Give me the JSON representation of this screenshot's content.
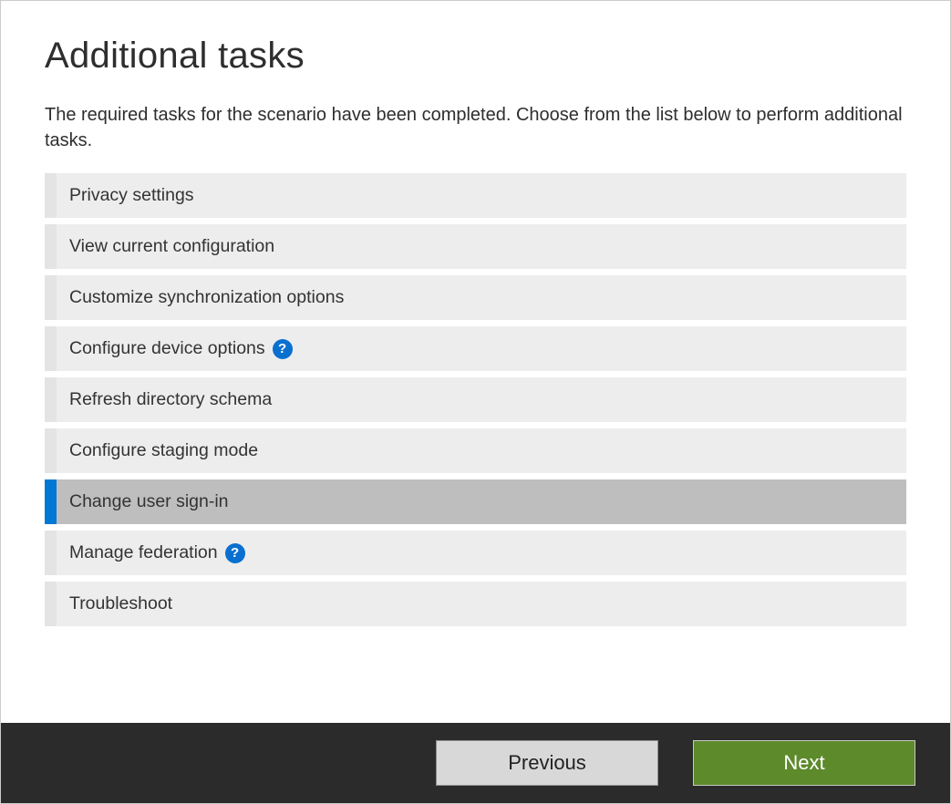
{
  "page": {
    "title": "Additional tasks",
    "description": "The required tasks for the scenario have been completed. Choose from the list below to perform additional tasks."
  },
  "tasks": [
    {
      "id": "privacy-settings",
      "label": "Privacy settings",
      "help": false,
      "selected": false
    },
    {
      "id": "view-current-configuration",
      "label": "View current configuration",
      "help": false,
      "selected": false
    },
    {
      "id": "customize-synchronization-options",
      "label": "Customize synchronization options",
      "help": false,
      "selected": false
    },
    {
      "id": "configure-device-options",
      "label": "Configure device options",
      "help": true,
      "selected": false
    },
    {
      "id": "refresh-directory-schema",
      "label": "Refresh directory schema",
      "help": false,
      "selected": false
    },
    {
      "id": "configure-staging-mode",
      "label": "Configure staging mode",
      "help": false,
      "selected": false
    },
    {
      "id": "change-user-sign-in",
      "label": "Change user sign-in",
      "help": false,
      "selected": true
    },
    {
      "id": "manage-federation",
      "label": "Manage federation",
      "help": true,
      "selected": false
    },
    {
      "id": "troubleshoot",
      "label": "Troubleshoot",
      "help": false,
      "selected": false
    }
  ],
  "footer": {
    "previous_label": "Previous",
    "next_label": "Next"
  },
  "colors": {
    "accent_selected": "#0078d4",
    "help_icon_bg": "#0a70d0",
    "next_button_bg": "#5d8a2b",
    "footer_bg": "#2b2b2b",
    "task_bg": "#ededed",
    "task_selected_bg": "#bfbebe"
  }
}
